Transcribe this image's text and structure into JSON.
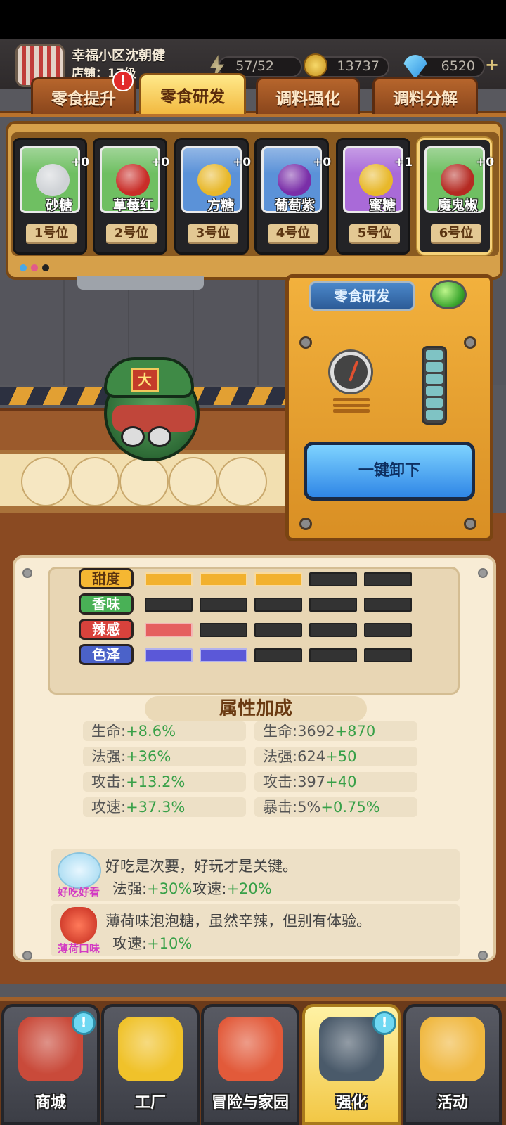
{
  "header": {
    "player_name": "幸福小区沈朝健",
    "shop_level": "店铺：17级",
    "resources": [
      {
        "icon": "lightning-icon",
        "value": "57/52"
      },
      {
        "icon": "gold-coin-icon",
        "value": "13737"
      },
      {
        "icon": "diamond-icon",
        "value": "6520"
      }
    ]
  },
  "tabs": [
    {
      "label": "零食提升",
      "active": false,
      "alert": "!"
    },
    {
      "label": "零食研发",
      "active": true
    },
    {
      "label": "调料强化",
      "active": false
    },
    {
      "label": "调料分解",
      "active": false
    }
  ],
  "slots": [
    {
      "name": "砂糖",
      "plus": "+0",
      "position": "1号位",
      "color": "#6fbf62",
      "icon": "candy-icon"
    },
    {
      "name": "草莓红",
      "plus": "+0",
      "position": "2号位",
      "color": "#6fbf62",
      "icon": "potion-bottle-icon"
    },
    {
      "name": "方糖",
      "plus": "+0",
      "position": "3号位",
      "color": "#5b92d8",
      "icon": "candy-icon"
    },
    {
      "name": "葡萄紫",
      "plus": "+0",
      "position": "4号位",
      "color": "#5b92d8",
      "icon": "potion-bottle-icon"
    },
    {
      "name": "蜜糖",
      "plus": "+1",
      "position": "5号位",
      "color": "#a96ad8",
      "icon": "honey-candy-icon"
    },
    {
      "name": "魔鬼椒",
      "plus": "+0",
      "position": "6号位",
      "color": "#6fbf62",
      "icon": "chili-jar-icon"
    }
  ],
  "machine": {
    "label": "零食研发",
    "unload_button": "一键卸下"
  },
  "character": {
    "badge": "大"
  },
  "attributes": [
    {
      "label": "甜度",
      "filled": 3,
      "total": 5,
      "color": "#f2b12e",
      "label_bg": "#f5b732"
    },
    {
      "label": "香味",
      "filled": 0,
      "total": 5,
      "color": "#54b85c",
      "label_bg": "#49b156"
    },
    {
      "label": "辣感",
      "filled": 1,
      "total": 5,
      "color": "#e55f5f",
      "label_bg": "#d8423c"
    },
    {
      "label": "色泽",
      "filled": 2,
      "total": 5,
      "color": "#5b58d8",
      "label_bg": "#4b62c9"
    }
  ],
  "bonus": {
    "title": "属性加成",
    "left": [
      {
        "key": "生命:",
        "value": "+8.6%"
      },
      {
        "key": "法强:",
        "value": "+36%"
      },
      {
        "key": "攻击:",
        "value": "+13.2%"
      },
      {
        "key": "攻速:",
        "value": "+37.3%"
      }
    ],
    "right": [
      {
        "key": "生命:3692",
        "value": "+870"
      },
      {
        "key": "法强:624",
        "value": "+50"
      },
      {
        "key": "攻击:397",
        "value": "+40"
      },
      {
        "key": "暴击:5%",
        "value": "+0.75%"
      }
    ]
  },
  "traits": [
    {
      "name": "好吃好看",
      "description": "好吃是次要，好玩才是关键。",
      "bonus_a_key": "法强:",
      "bonus_a_val": "+30%",
      "bonus_b_key": "攻速:",
      "bonus_b_val": "+20%"
    },
    {
      "name": "薄荷口味",
      "description": "薄荷味泡泡糖，虽然辛辣，但别有体验。",
      "bonus_a_key": "攻速:",
      "bonus_a_val": "+10%"
    }
  ],
  "nav": [
    {
      "label": "商城",
      "icon": "shopping-cart-icon",
      "active": false,
      "bubble": "!"
    },
    {
      "label": "工厂",
      "icon": "factory-icon",
      "active": false
    },
    {
      "label": "冒险与家园",
      "icon": "adventure-icon",
      "active": false
    },
    {
      "label": "强化",
      "icon": "robot-enhance-icon",
      "active": true,
      "bubble": "!"
    },
    {
      "label": "活动",
      "icon": "trumpet-icon",
      "active": false
    }
  ]
}
